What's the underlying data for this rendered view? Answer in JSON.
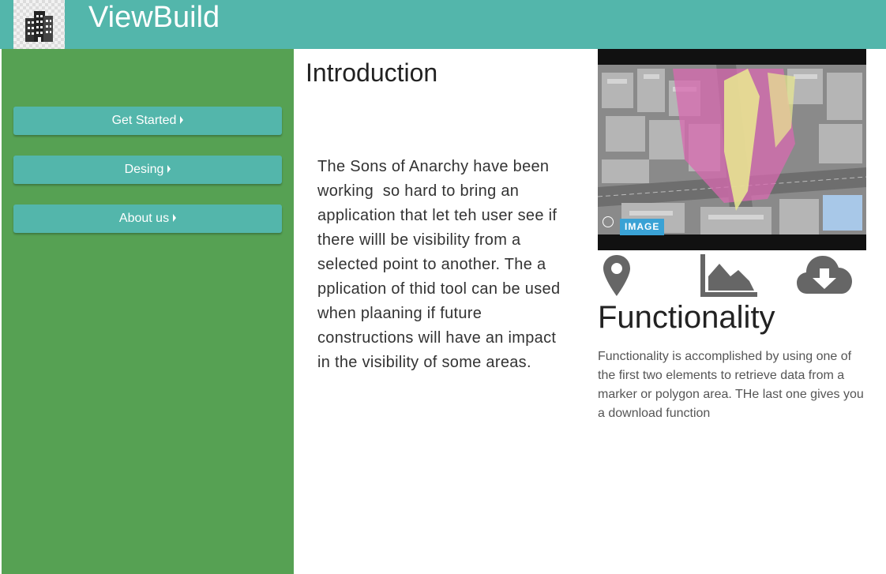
{
  "header": {
    "title": "ViewBuild",
    "logo_icon": "building-icon"
  },
  "sidebar": {
    "items": [
      {
        "label": "Get Started",
        "icon": "caret-right-icon"
      },
      {
        "label": "Desing",
        "icon": "caret-right-icon"
      },
      {
        "label": "About us",
        "icon": "caret-right-icon"
      }
    ]
  },
  "intro": {
    "title": "Introduction",
    "text": "The Sons of Anarchy have been working  so hard to bring an application that let teh user see if there willl be visibility from a selected point to another. The a pplication of thid tool can be used when plaaning if future constructions will have an impact in the visibility of some areas."
  },
  "image_panel": {
    "badge": "IMAGE"
  },
  "functionality": {
    "icons": [
      "map-marker-icon",
      "area-chart-icon",
      "cloud-download-icon"
    ],
    "title": "Functionality",
    "text": "Functionality is accomplished by using one of the first two elements to retrieve data from a marker or polygon area. THe last one gives you a download function"
  },
  "colors": {
    "header": "#53b6ab",
    "sidebar": "#56a153",
    "button": "#53b6ab",
    "badge": "#3aa2d5",
    "icon": "#666666"
  }
}
